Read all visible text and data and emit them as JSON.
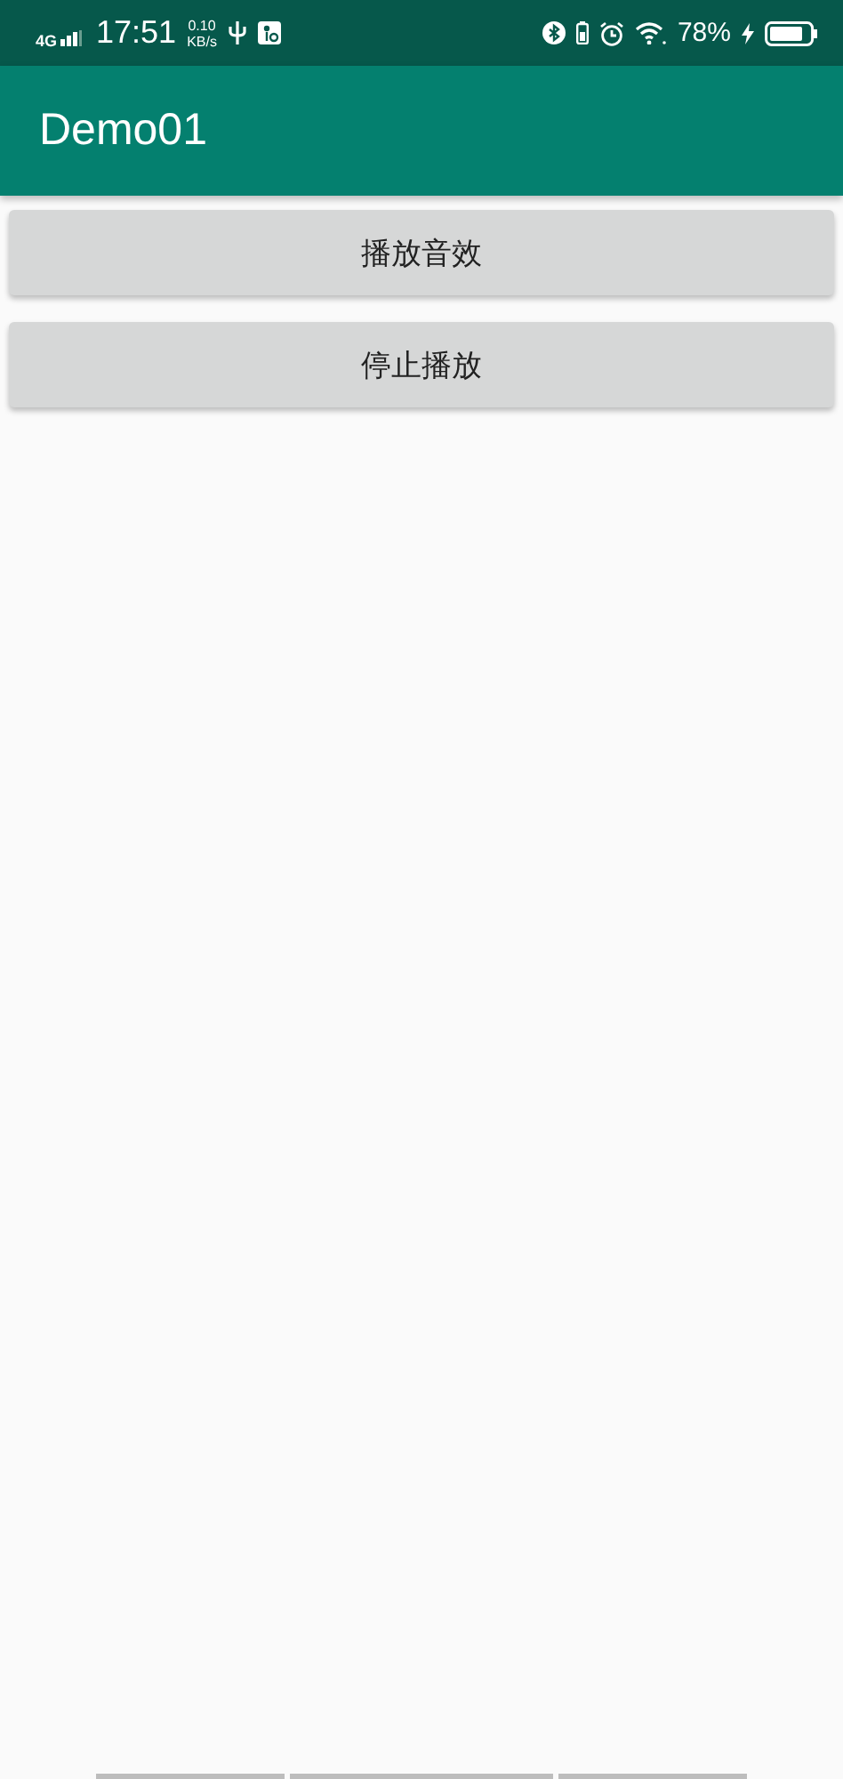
{
  "status_bar": {
    "network": "4G",
    "time": "17:51",
    "speed_value": "0.10",
    "speed_unit": "KB/s",
    "battery_percent": "78%",
    "charging": true
  },
  "app_bar": {
    "title": "Demo01"
  },
  "buttons": [
    {
      "label": "播放音效"
    },
    {
      "label": "停止播放"
    }
  ]
}
